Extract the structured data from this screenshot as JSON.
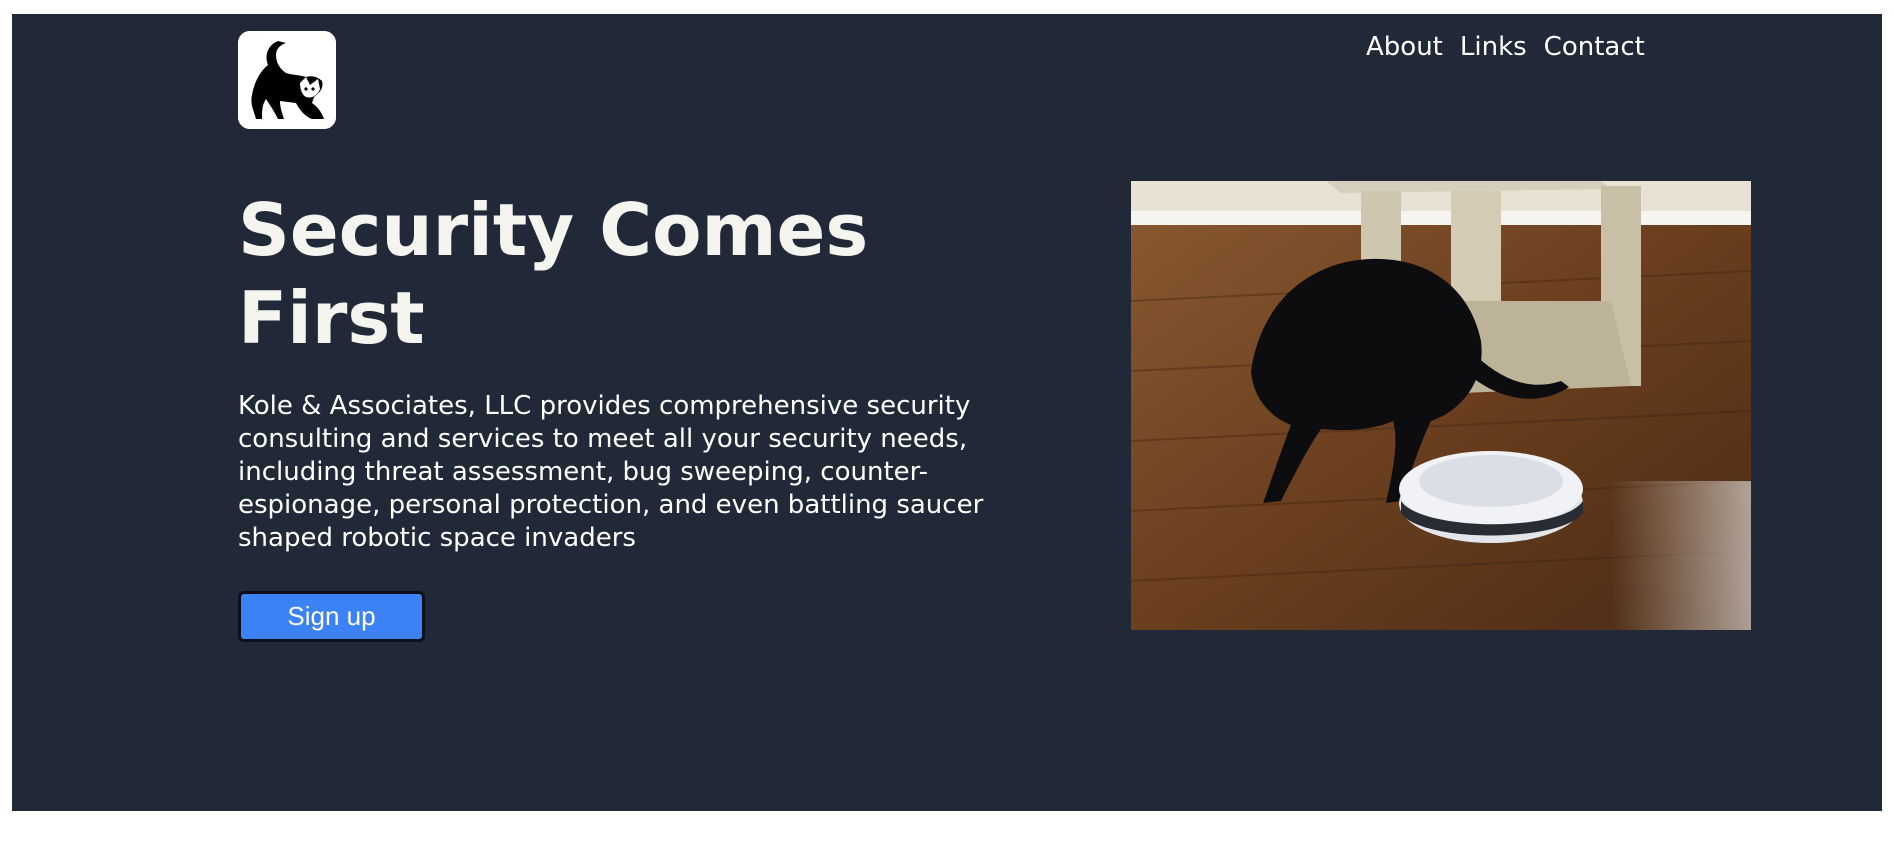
{
  "header": {
    "logo_icon": "cat-logo-icon",
    "nav": [
      {
        "label": "About"
      },
      {
        "label": "Links"
      },
      {
        "label": "Contact"
      }
    ]
  },
  "hero": {
    "title": "Security Comes First",
    "description": "Kole & Associates, LLC provides comprehensive security consulting and services to meet all your security needs, including threat assessment, bug sweeping, counter-espionage, personal protection, and even battling saucer shaped robotic space invaders",
    "cta_label": "Sign up",
    "image_subject": "black-cat-with-robot-vacuum-photo"
  },
  "colors": {
    "hero_background": "#212838",
    "button_background": "#3b82f6",
    "text": "#ffffff"
  }
}
